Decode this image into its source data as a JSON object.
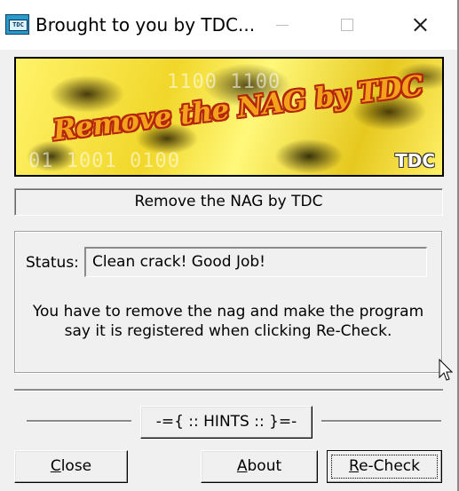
{
  "window": {
    "title": "Brought to you by TDC...",
    "icon_text": "TDC"
  },
  "banner": {
    "title": "Remove the NAG by TDC",
    "bits_top": "1100 1100",
    "bits_bottom": "01  1001  0100",
    "logo": "TDC"
  },
  "caption": "Remove the NAG by TDC",
  "status": {
    "label": "Status:",
    "value": "Clean crack! Good Job!"
  },
  "info": "You have to remove the nag and make the program\nsay it is registered when clicking Re-Check.",
  "buttons": {
    "hints": "-={ :: HINTS :: }=-",
    "close_accel": "C",
    "close_rest": "lose",
    "about_accel": "A",
    "about_rest": "bout",
    "recheck_accel": "R",
    "recheck_rest": "e-Check"
  },
  "icons": {
    "app": "tdc-app-icon",
    "minimize": "minimize-icon",
    "maximize": "maximize-icon",
    "close": "close-icon",
    "cursor": "mouse-cursor-icon"
  }
}
